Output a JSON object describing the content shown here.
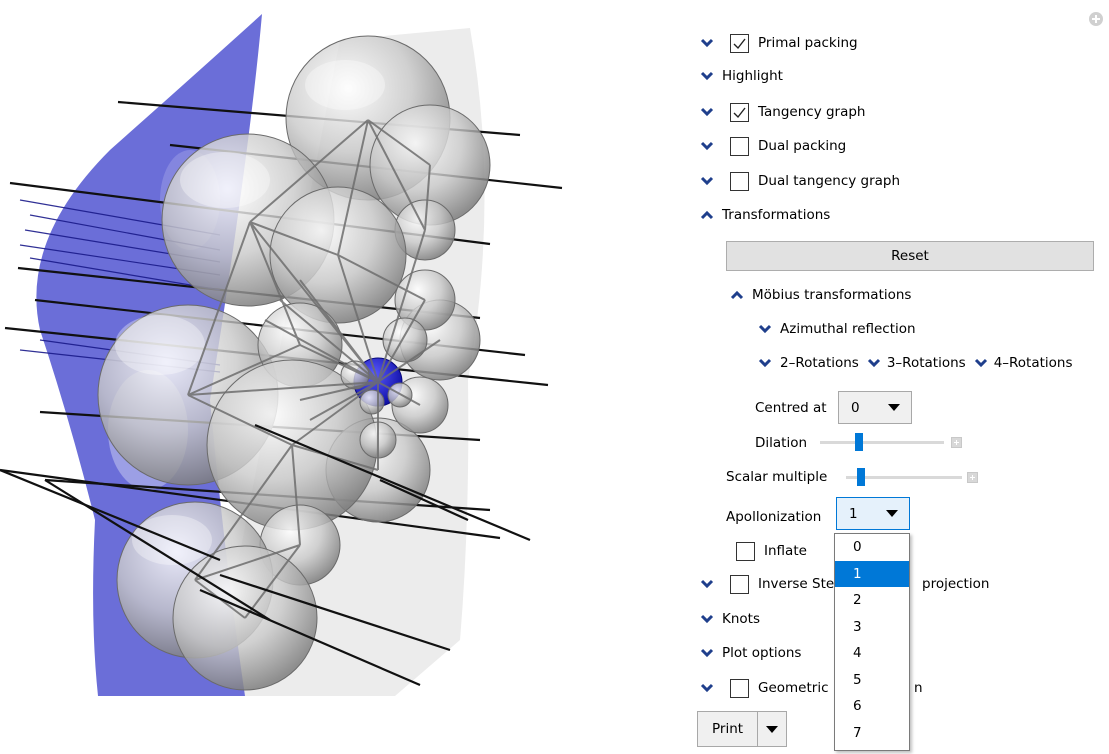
{
  "panel": {
    "primal_packing": {
      "label": "Primal packing",
      "checked": true
    },
    "highlight": {
      "label": "Highlight"
    },
    "tangency_graph": {
      "label": "Tangency graph",
      "checked": true
    },
    "dual_packing": {
      "label": "Dual packing",
      "checked": false
    },
    "dual_tangency_graph": {
      "label": "Dual tangency graph",
      "checked": false
    },
    "transformations": {
      "label": "Transformations",
      "reset_label": "Reset",
      "mobius": {
        "label": "Möbius transformations",
        "azimuthal": "Azimuthal reflection",
        "rot2": "2–Rotations",
        "rot3": "3–Rotations",
        "rot4": "4–Rotations",
        "centred_label": "Centred at",
        "centred_value": "0",
        "dilation_label": "Dilation",
        "dilation_value": 0.3
      },
      "scalar_label": "Scalar multiple",
      "scalar_value": 0.1,
      "apollonization_label": "Apollonization",
      "apollonization_value": "1",
      "apollonization_options": [
        "0",
        "1",
        "2",
        "3",
        "4",
        "5",
        "6",
        "7"
      ],
      "apollonization_selected_index": 1,
      "inflate": {
        "label": "Inflate",
        "checked": false
      },
      "inverse_label_left": "Inverse Ste",
      "inverse_label_right": "projection"
    },
    "knots": {
      "label": "Knots"
    },
    "plot_options": {
      "label": "Plot options"
    },
    "geometric": {
      "label_left": "Geometric",
      "label_right": "n",
      "checked": false
    },
    "print_label": "Print"
  },
  "colors": {
    "chevron": "#1f3f8c",
    "accent": "#0078d7",
    "plane": "#6b6ed8"
  }
}
